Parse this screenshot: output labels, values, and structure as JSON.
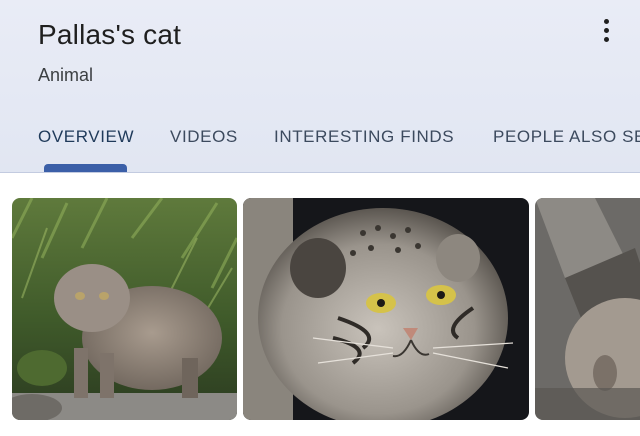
{
  "header": {
    "title": "Pallas's cat",
    "subtitle": "Animal",
    "menu_icon": "more-vert-icon"
  },
  "tabs": [
    {
      "label": "OVERVIEW",
      "active": true
    },
    {
      "label": "VIDEOS",
      "active": false
    },
    {
      "label": "INTERESTING FINDS",
      "active": false
    },
    {
      "label": "PEOPLE ALSO SEARCH FOR",
      "active": false
    }
  ],
  "colors": {
    "header_bg": "#e5e9f4",
    "tab_indicator": "#3b5fa8",
    "title_text": "#1f1f1f"
  }
}
